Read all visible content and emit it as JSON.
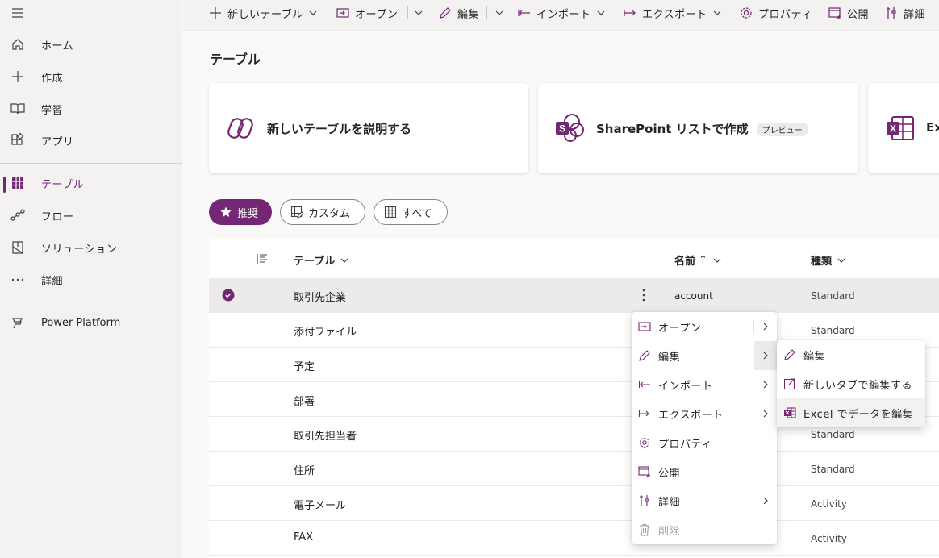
{
  "nav": {
    "items": [
      {
        "label": "ホーム",
        "icon": "home-icon"
      },
      {
        "label": "作成",
        "icon": "plus-icon"
      },
      {
        "label": "学習",
        "icon": "book-icon"
      },
      {
        "label": "アプリ",
        "icon": "apps-icon"
      },
      {
        "label": "テーブル",
        "icon": "table-grid-icon"
      },
      {
        "label": "フロー",
        "icon": "flow-icon"
      },
      {
        "label": "ソリューション",
        "icon": "solution-icon"
      },
      {
        "label": "詳細",
        "icon": "more-icon"
      },
      {
        "label": "Power Platform",
        "icon": "power-platform-icon"
      }
    ],
    "active_index": 4
  },
  "toolbar": {
    "new_table": "新しいテーブル",
    "open": "オープン",
    "edit": "編集",
    "import": "インポート",
    "export": "エクスポート",
    "properties": "プロパティ",
    "publish": "公開",
    "more": "詳細"
  },
  "page": {
    "title": "テーブル"
  },
  "cards": [
    {
      "title": "新しいテーブルを説明する",
      "icon": "copilot-icon"
    },
    {
      "title": "SharePoint リストで作成",
      "badge": "プレビュー",
      "icon": "sharepoint-icon"
    },
    {
      "title": "Ex",
      "icon": "excel-icon"
    }
  ],
  "filters": {
    "recommended": "推奨",
    "custom": "カスタム",
    "all": "すべて"
  },
  "grid": {
    "col_table": "テーブル",
    "col_name": "名前",
    "col_name_sort": "↑",
    "col_type": "種類",
    "rows": [
      {
        "table": "取引先企業",
        "name": "account",
        "type": "Standard"
      },
      {
        "table": "添付ファイル",
        "name": "",
        "type": "Standard"
      },
      {
        "table": "予定",
        "name": "",
        "type": ""
      },
      {
        "table": "部署",
        "name": "",
        "type": ""
      },
      {
        "table": "取引先担当者",
        "name": "",
        "type": "Standard"
      },
      {
        "table": "住所",
        "name": "",
        "type": "Standard"
      },
      {
        "table": "電子メール",
        "name": "",
        "type": "Activity"
      },
      {
        "table": "FAX",
        "name": "",
        "type": "Activity"
      }
    ]
  },
  "context_menu": {
    "items": [
      {
        "label": "オープン",
        "icon": "open-icon"
      },
      {
        "label": "編集",
        "icon": "pencil-icon"
      },
      {
        "label": "インポート",
        "icon": "import-icon"
      },
      {
        "label": "エクスポート",
        "icon": "export-icon"
      },
      {
        "label": "プロパティ",
        "icon": "gear-icon"
      },
      {
        "label": "公開",
        "icon": "publish-icon"
      },
      {
        "label": "詳細",
        "icon": "tools-icon"
      },
      {
        "label": "削除",
        "icon": "trash-icon"
      }
    ]
  },
  "edit_submenu": {
    "items": [
      {
        "label": "編集",
        "icon": "pencil-icon"
      },
      {
        "label": "新しいタブで編集する",
        "icon": "open-new-tab-icon"
      },
      {
        "label": "Excel でデータを編集",
        "icon": "excel-icon"
      }
    ]
  },
  "colors": {
    "accent": "#742774",
    "excel": "#217346",
    "sharepoint": "#036c70"
  }
}
